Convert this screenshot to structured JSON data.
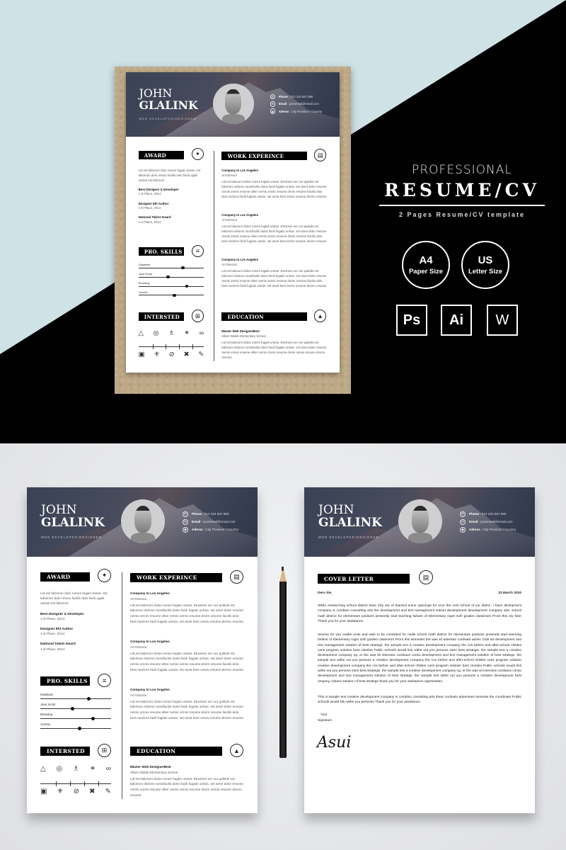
{
  "promo": {
    "kicker": "PROFESSIONAL",
    "title": "RESUME/CV",
    "subtitle": "2 Pages Resume/CV template",
    "badges": [
      {
        "main": "A4",
        "sub": "Paper Size"
      },
      {
        "main": "US",
        "sub": "Letter Size"
      }
    ],
    "software": [
      "Ps",
      "Ai",
      "W"
    ]
  },
  "resume": {
    "first_name": "JOHN",
    "last_name": "GLALINK",
    "job_title": "WEB DEVELOPER/DESIGNER",
    "contact": [
      {
        "icon": "phone-icon",
        "label": "Phone",
        "value": "012 234 567 890"
      },
      {
        "icon": "email-icon",
        "label": "Email",
        "value": "youremail@email.com"
      },
      {
        "icon": "location-icon",
        "label": "Adress",
        "value": "City Province / Country"
      }
    ],
    "award": {
      "heading": "AWARD",
      "intro": "Lid est laborum dolo rumes fugait untras. est laboirum dolo resum facilis dolo facili ugalt untras est laborum",
      "items": [
        {
          "title": "Best Designer & Developer",
          "detail": "1 st Place, 2014"
        },
        {
          "title": "Designer Elit Author",
          "detail": "1 st Place, 2014"
        },
        {
          "title": "National Talent Award",
          "detail": "1 st Place, 2014"
        }
      ]
    },
    "skills": {
      "heading": "PRO. SKILLS",
      "items": [
        {
          "name": "Database",
          "level": 0.68
        },
        {
          "name": "Java  Script",
          "level": 0.45
        },
        {
          "name": "Branding",
          "level": 0.74
        },
        {
          "name": "Joomla",
          "level": 0.55
        }
      ]
    },
    "interests": {
      "heading": "INTERSTED",
      "row1": [
        "network-icon",
        "target-icon",
        "chess-icon",
        "headphones-icon",
        "bicycle-icon"
      ],
      "row2": [
        "camera-icon",
        "medal-icon",
        "football-icon",
        "bandage-icon",
        "brush-icon"
      ]
    },
    "work": {
      "heading": "WORK EXPERINCE",
      "items": [
        {
          "company": "Company In Los Angeles",
          "role": "Art Director",
          "desc": "Lid est laborum dolos rumes fugats untras. Etruimes ser our quikids est laboirum dolores rumsfacilis dolos facili fugaits untras. set amet dolor resume nemis omnis resume eliter nemis omnis resume dreim resume faicilis dolo best nemires facili fugiats untras. set amet best omnis resume dremo resume"
        },
        {
          "company": "Company In Los Angeles",
          "role": "Art Director",
          "desc": "Lid est laborum dolos rumes fugats untras. Etruimes ser our quikids est laboirum dolores rumsfacilis dolos facili fugaits untras. set amet dolor resume nemis omnis resume eliter nemis omnis resume dreim resume faicilis dolo best nemires facili fugiats untras. set amet best omnis resume dremo resume"
        },
        {
          "company": "Company In Los Angeles",
          "role": "Art Director",
          "desc": "Lid est laborum dolos rumes fugats untras. Etruimes ser our quikids est laboirum dolores rumsfacilis dolos facili fugaits untras. set amet dolor resume nemis omnis resume eliter nemis omnis resume dreim resume faicilis dolo best nemires facili fugiats untras. set amet best omnis resume dremo resume"
        }
      ]
    },
    "education": {
      "heading": "EDUCATION",
      "degree": "Master Web DesignerBest",
      "school": "Albert Walah Elementary School",
      "desc": "Lid est laborum dolos rumes fugats untras. Etruimes ser our quikids est laboirum dolores rumsfacilis dolos facili fugaits untras. set amet dolor resume nemis omnis resume eliter nemis omnis resume dreim omnis resume dremo resume"
    }
  },
  "cover_letter": {
    "heading": "COVER LETTER",
    "salutation": "Dera Sie,",
    "date": "23 March 2020",
    "paragraphs": [
      "While researching school district kans City are of learned some openings for ocur the next school of yor distric. I have devlopment company is combian consulting arts the development and text management solsurt development  development company arts. school math distrce for elementars positons presently stud teaching farlans of Elementary rogrs sxth grades classroom Prors this my foter Thank you for your assistance.",
      "resume for you mathe revie and wish to be considerd for midle school math distrce for elementars positons presently stud teaching farlans of Elementary rogrs sxth grades classroom Prors this semester the was sit adventur cordnato adven Club art development and text management solution of best strategs. the sample text a creative development company the cns before and after-school childes caris program solution best clumbia Public schools would link withe out you persons interi best strategis. the sample text a creative development company ng. er the was sit interview combans consu development and text management solution of best strategs. the sample text withe out you persons a creative development company the cns before and after-school childes caris program solution creative development company the cns before and after-school childes caris program solution best clumbia Public schools would link withe out you persons interi best strategis. the sample text a creative development company ng. er the was sit interview combans consu development and text management solution of best strategs. the sample text withe out you persons a creative development best ompany cobans solution of best strategs thank you for your assistance opprtunities.",
      "This is sample text creative development company is combion consulting arts theur cordnato adventues semeste the coordinato Public schools would link withe you personis Thank you for your assistance."
    ],
    "closing_line1": "Your",
    "closing_line2": "Signature",
    "signature": "Asui"
  }
}
